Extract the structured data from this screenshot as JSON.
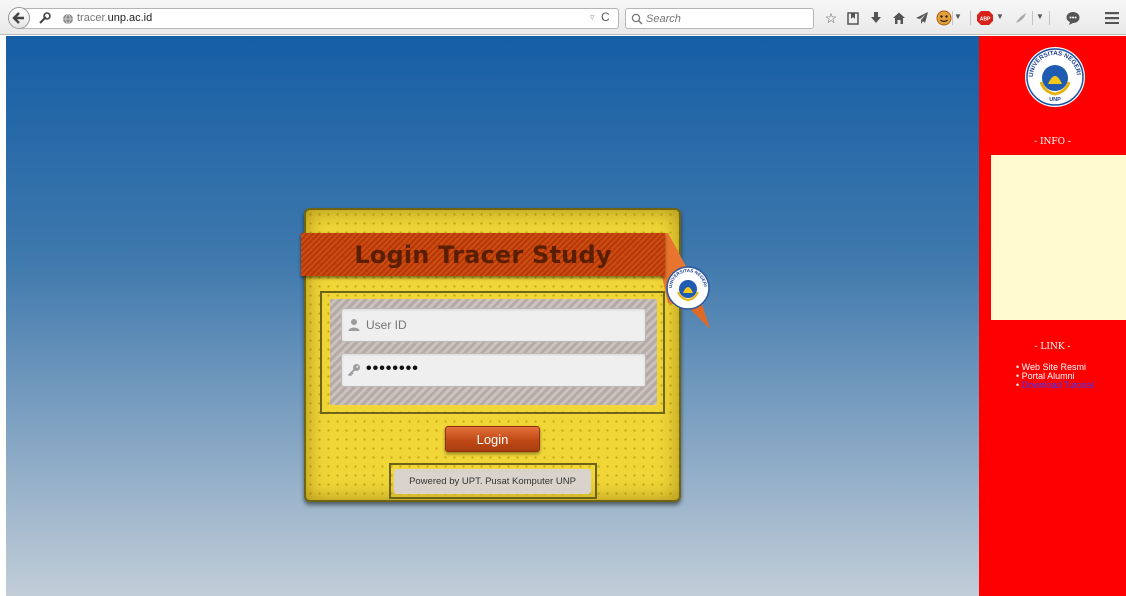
{
  "browser": {
    "url_prefix": "tracer.",
    "url_domain": "unp.ac.id",
    "search_placeholder": "Search"
  },
  "login": {
    "title": "Login Tracer Study",
    "user_placeholder": "User ID",
    "password_value": "••••••••",
    "button_label": "Login",
    "powered_by": "Powered by UPT. Pusat Komputer UNP"
  },
  "sidebar": {
    "logo_text": "UNIVERSITAS NEGERI PADANG",
    "logo_short": "UNP",
    "info_heading": "- INFO -",
    "link_heading": "- LINK -",
    "links": [
      "Web Site Resmi",
      "Portal Alumni",
      "Download Tutorial"
    ]
  },
  "colors": {
    "sidebar_bg": "#ff0000",
    "card_yellow": "#f0d637",
    "ribbon_orange": "#c2440d",
    "info_box": "#fffad0"
  },
  "icons": [
    "back-arrow-icon",
    "site-identity-icon",
    "globe-icon",
    "reload-icon",
    "search-icon",
    "bookmark-star-icon",
    "reading-list-icon",
    "download-icon",
    "home-icon",
    "send-icon",
    "smiley-addon-icon",
    "adblock-icon",
    "addon-icon",
    "chat-icon",
    "menu-icon",
    "user-icon",
    "key-icon",
    "unp-logo-icon"
  ]
}
